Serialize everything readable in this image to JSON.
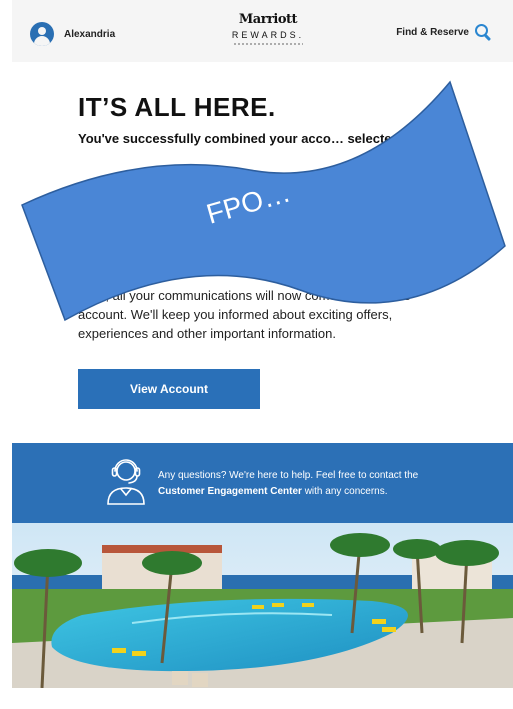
{
  "header": {
    "user_name": "Alexandria",
    "brand": "Marriott",
    "brand_sub": "REWARDS.",
    "find_label": "Find & Reserve"
  },
  "hero": {
    "headline": "IT’S ALL HERE.",
    "intro": "You've successfully combined your acco… selected M…",
    "body": "…on, all your communications will now come through …is account. We'll keep you informed about exciting offers, experiences and other important information.",
    "button_label": "View Account"
  },
  "help": {
    "text_before": "Any questions? We're here to help. Feel free to contact the ",
    "link_text": "Customer Engagement Center",
    "text_after": " with any concerns."
  },
  "overlay": {
    "label": "FPO…",
    "color": "#4a86d6"
  }
}
